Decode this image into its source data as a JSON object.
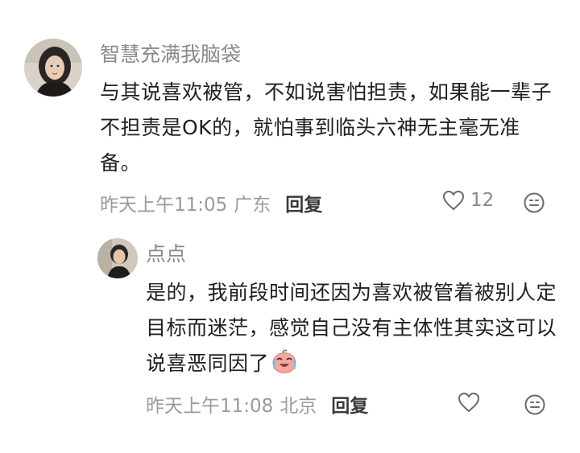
{
  "comments": [
    {
      "username": "智慧充满我脑袋",
      "avatar_icon": "avatar-woman-photo",
      "text": "与其说喜欢被管，不如说害怕担责，如果能一辈子不担责是OK的，就怕事到临头六神无主毫无准备。",
      "time": "昨天上午11:05",
      "location": "广东",
      "reply_label": "回复",
      "like_count": "12",
      "like_icon": "heart-outline-icon",
      "more_icon": "face-emoji-icon"
    },
    {
      "username": "点点",
      "avatar_icon": "avatar-man-photo",
      "text": "是的，我前段时间还因为喜欢被管着被别人定目标而迷茫，感觉自己没有主体性其实这可以说喜恶同因了",
      "emoji_icon": "crying-laughing-emoji",
      "time": "昨天上午11:08",
      "location": "北京",
      "reply_label": "回复",
      "like_icon": "heart-outline-icon",
      "more_icon": "face-emoji-icon"
    }
  ],
  "colors": {
    "username": "#8a8a8a",
    "body": "#1f1f1f",
    "meta": "#9a9a9a",
    "reply": "#3a3a3a",
    "background": "#ffffff"
  }
}
